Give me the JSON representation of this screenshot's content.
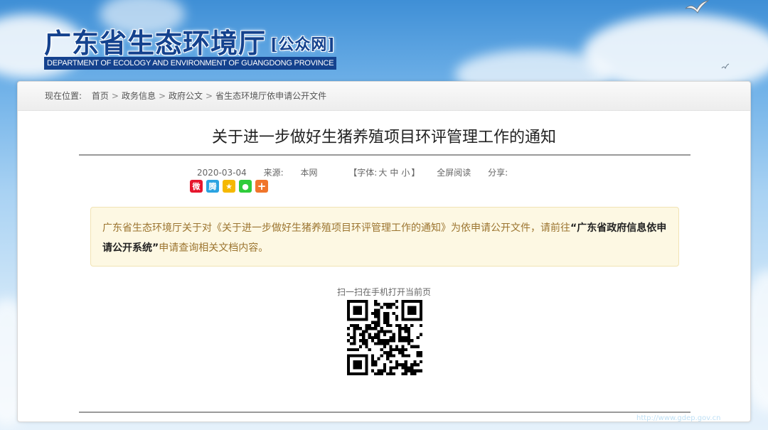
{
  "header": {
    "title_cn": "广东省生态环境厅",
    "badge": "[公众网]",
    "title_en": "DEPARTMENT OF ECOLOGY AND ENVIRONMENT OF GUANGDONG PROVINCE"
  },
  "breadcrumb": {
    "lead": "现在位置:",
    "items": [
      "首页",
      "政务信息",
      "政府公文",
      "省生态环境厅依申请公开文件"
    ],
    "separator": ">"
  },
  "article": {
    "title": "关于进一步做好生猪养殖项目环评管理工作的通知",
    "date": "2020-03-04",
    "source_label": "来源:",
    "source_value": "本网",
    "font_label": "【字体:",
    "font_sizes": [
      "大",
      "中",
      "小"
    ],
    "font_close": "】",
    "fullscreen": "全屏阅读",
    "share_label": "分享:"
  },
  "share_icons": [
    {
      "name": "weibo-icon",
      "glyph": "微",
      "color": "#e6162d"
    },
    {
      "name": "tencent-weibo-icon",
      "glyph": "腾",
      "color": "#2aa3e1"
    },
    {
      "name": "qzone-icon",
      "glyph": "★",
      "color": "#f5b800"
    },
    {
      "name": "wechat-icon",
      "glyph": "●",
      "color": "#2ecc3a"
    },
    {
      "name": "more-share-icon",
      "glyph": "+",
      "color": "#f0752b"
    }
  ],
  "notice": {
    "part1": "广东省生态环境厅关于对《关于进一步做好生猪养殖项目环评管理工作的通知》为依申请公开文件，请前往",
    "link": "“广东省政府信息依申请公开系统”",
    "part2": "申请查询相关文档内容。"
  },
  "qr": {
    "caption": "扫一扫在手机打开当前页"
  },
  "watermark": "http://www.gdep.gov.cn"
}
